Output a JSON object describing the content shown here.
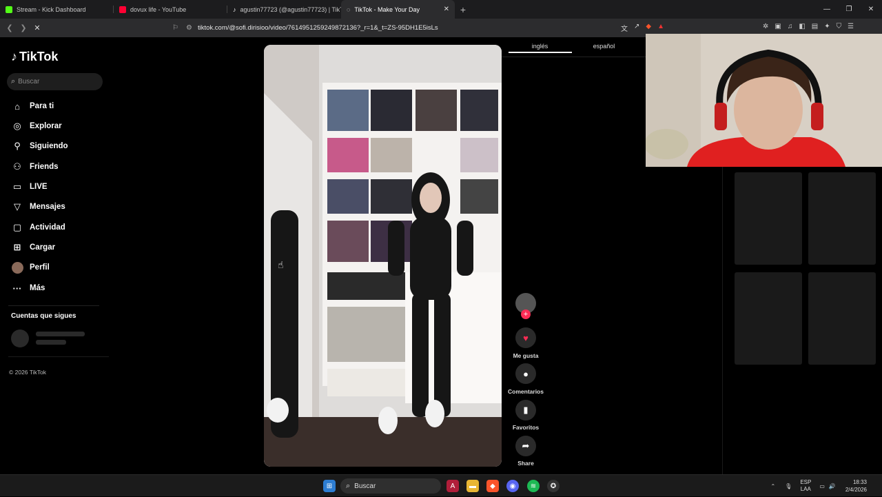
{
  "tabs": [
    {
      "title": "Stream - Kick Dashboard",
      "color": "#53fc18"
    },
    {
      "title": "dovux life - YouTube",
      "color": "#ff0033"
    },
    {
      "title": "agustin77723 (@agustin77723) | TikT",
      "color": "#ffffff"
    },
    {
      "title": "TikTok - Make Your Day",
      "color": "#ffffff"
    }
  ],
  "address": {
    "url": "tiktok.com/@sofi.dirisioo/video/7614951259249872136?_r=1&_t=ZS-95DH1E5isLs"
  },
  "sidebar": {
    "logo": "TikTok",
    "search_placeholder": "Buscar",
    "items": [
      {
        "label": "Para ti",
        "icon": "home-icon"
      },
      {
        "label": "Explorar",
        "icon": "compass-icon"
      },
      {
        "label": "Siguiendo",
        "icon": "following-icon"
      },
      {
        "label": "Friends",
        "icon": "friends-icon"
      },
      {
        "label": "LIVE",
        "icon": "live-icon"
      },
      {
        "label": "Mensajes",
        "icon": "messages-icon"
      },
      {
        "label": "Actividad",
        "icon": "activity-icon"
      },
      {
        "label": "Cargar",
        "icon": "upload-icon"
      },
      {
        "label": "Perfil",
        "icon": "profile-avatar-icon"
      },
      {
        "label": "Más",
        "icon": "more-icon"
      }
    ],
    "following_title": "Cuentas que sigues",
    "copyright": "© 2026 TikTok"
  },
  "actions": {
    "like": "Me gusta",
    "comments": "Comentarios",
    "favorites": "Favoritos",
    "share": "Share"
  },
  "comments_panel": {
    "tabs": [
      "inglés",
      "español"
    ]
  },
  "taskbar": {
    "search": "Buscar",
    "lang_top": "ESP",
    "lang_bottom": "LAA",
    "time": "18:33",
    "date": "2/4/2026"
  },
  "colors": {
    "accent": "#fe2c55",
    "page_bg": "#000000"
  }
}
